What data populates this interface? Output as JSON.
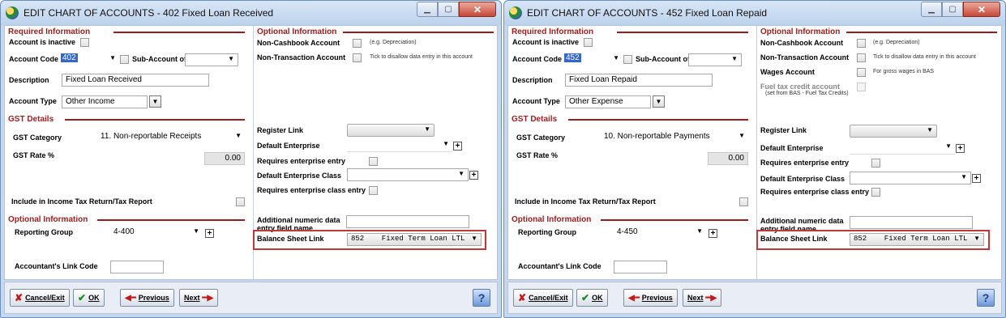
{
  "windows": [
    {
      "title": "EDIT CHART OF ACCOUNTS - 402 Fixed Loan Received",
      "sections": {
        "required_info": "Required Information",
        "optional_info_top": "Optional Information",
        "gst_details": "GST Details",
        "optional_info_bottom": "Optional Information"
      },
      "labels": {
        "account_inactive": "Account is inactive",
        "account_code": "Account Code",
        "sub_account_of": "Sub-Account of",
        "description": "Description",
        "account_type": "Account Type",
        "gst_category": "GST Category",
        "gst_rate": "GST Rate %",
        "include_tax": "Include in Income Tax Return/Tax Report",
        "reporting_group": "Reporting Group",
        "accountant_link": "Accountant's Link Code",
        "non_cashbook": "Non-Cashbook Account",
        "non_cashbook_hint": "(e.g. Depreciation)",
        "non_transaction": "Non-Transaction Account",
        "non_transaction_hint": "Tick to disallow data entry in this account",
        "register_link": "Register Link",
        "default_enterprise": "Default Enterprise",
        "requires_enterprise": "Requires enterprise entry",
        "default_enterprise_class": "Default Enterprise Class",
        "requires_enterprise_class": "Requires enterprise class entry",
        "additional_numeric": "Additional numeric data",
        "additional_numeric_2": "entry field name",
        "balance_sheet_link": "Balance Sheet Link"
      },
      "values": {
        "account_code": "402",
        "description": "Fixed Loan Received",
        "account_type": "Other Income",
        "gst_category": "11. Non-reportable Receipts",
        "gst_rate": "0.00",
        "reporting_group": "4-400",
        "balance_sheet_link": "852    Fixed Term Loan LTL"
      },
      "buttons": {
        "cancel": "Cancel/Exit",
        "ok": "OK",
        "previous": "Previous",
        "next": "Next",
        "help": "?"
      }
    },
    {
      "title": "EDIT CHART OF ACCOUNTS - 452 Fixed Loan Repaid",
      "sections": {
        "required_info": "Required Information",
        "optional_info_top": "Optional Information",
        "gst_details": "GST Details",
        "optional_info_bottom": "Optional Information"
      },
      "labels": {
        "account_inactive": "Account is inactive",
        "account_code": "Account Code",
        "sub_account_of": "Sub-Account of",
        "description": "Description",
        "account_type": "Account Type",
        "gst_category": "GST Category",
        "gst_rate": "GST Rate %",
        "include_tax": "Include in Income Tax Return/Tax Report",
        "reporting_group": "Reporting Group",
        "accountant_link": "Accountant's Link Code",
        "non_cashbook": "Non-Cashbook Account",
        "non_cashbook_hint": "(e.g. Depreciation)",
        "non_transaction": "Non-Transaction Account",
        "non_transaction_hint": "Tick to disallow data entry in this account",
        "wages_account": "Wages Account",
        "wages_hint": "For gross wages in BAS",
        "fuel_tax": "Fuel tax credit account",
        "fuel_tax_hint": "(set from BAS - Fuel Tax Credits)",
        "register_link": "Register Link",
        "default_enterprise": "Default Enterprise",
        "requires_enterprise": "Requires enterprise entry",
        "default_enterprise_class": "Default Enterprise Class",
        "requires_enterprise_class": "Requires enterprise class entry",
        "additional_numeric": "Additional numeric data",
        "additional_numeric_2": "entry field name",
        "balance_sheet_link": "Balance Sheet Link"
      },
      "values": {
        "account_code": "452",
        "description": "Fixed Loan Repaid",
        "account_type": "Other Expense",
        "gst_category": "10. Non-reportable Payments",
        "gst_rate": "0.00",
        "reporting_group": "4-450",
        "balance_sheet_link": "852    Fixed Term Loan LTL"
      },
      "buttons": {
        "cancel": "Cancel/Exit",
        "ok": "OK",
        "previous": "Previous",
        "next": "Next",
        "help": "?"
      }
    }
  ],
  "colors": {
    "section_red": "#9b1d1d",
    "highlight_frame": "#c23838",
    "selection_blue": "#3468c8"
  },
  "icons": [
    "app-icon",
    "minimize-icon",
    "maximize-icon",
    "close-icon",
    "dropdown-arrow-icon",
    "plus-icon",
    "cancel-x-icon",
    "ok-check-icon",
    "arrow-left-icon",
    "arrow-right-icon",
    "help-icon"
  ]
}
